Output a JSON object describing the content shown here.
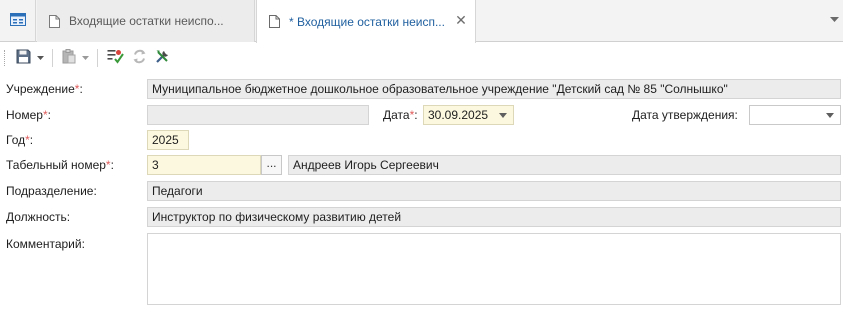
{
  "tabs": [
    {
      "title": "Входящие остатки неиспо...",
      "modified": false,
      "active": false
    },
    {
      "title": "* Входящие остатки неисп...",
      "modified": true,
      "active": true,
      "close_glyph": "✕"
    }
  ],
  "toolbar": {
    "buttons": [
      "save-icon",
      "paste-icon",
      "check-icon",
      "refresh-icon",
      "tools-icon"
    ]
  },
  "form": {
    "institution": {
      "label": "Учреждение",
      "required_mark": "*",
      "suffix": ":",
      "value": "Муниципальное бюджетное дошкольное образовательное учреждение \"Детский сад № 85 \"Солнышко\""
    },
    "number": {
      "label": "Номер",
      "required_mark": "*",
      "suffix": ":",
      "value": ""
    },
    "date": {
      "label": "Дата",
      "required_mark": "*",
      "suffix": ":",
      "value": "30.09.2025"
    },
    "approval_date": {
      "label": "Дата утверждения:",
      "value": ""
    },
    "year": {
      "label": "Год",
      "required_mark": "*",
      "suffix": ":",
      "value": "2025"
    },
    "tab_number": {
      "label": "Табельный номер",
      "required_mark": "*",
      "suffix": ":",
      "value": "3",
      "button": "...",
      "employee_name": "Андреев Игорь Сергеевич"
    },
    "department": {
      "label": "Подразделение:",
      "value": "Педагоги"
    },
    "position": {
      "label": "Должность:",
      "value": "Инструктор по физическому развитию детей"
    },
    "comment": {
      "label": "Комментарий:",
      "value": ""
    }
  },
  "colors": {
    "active_tab_text": "#1f5f9f",
    "required_mark": "#e05a5a",
    "readonly_field": "#ececec",
    "required_field": "#fcf8df"
  }
}
